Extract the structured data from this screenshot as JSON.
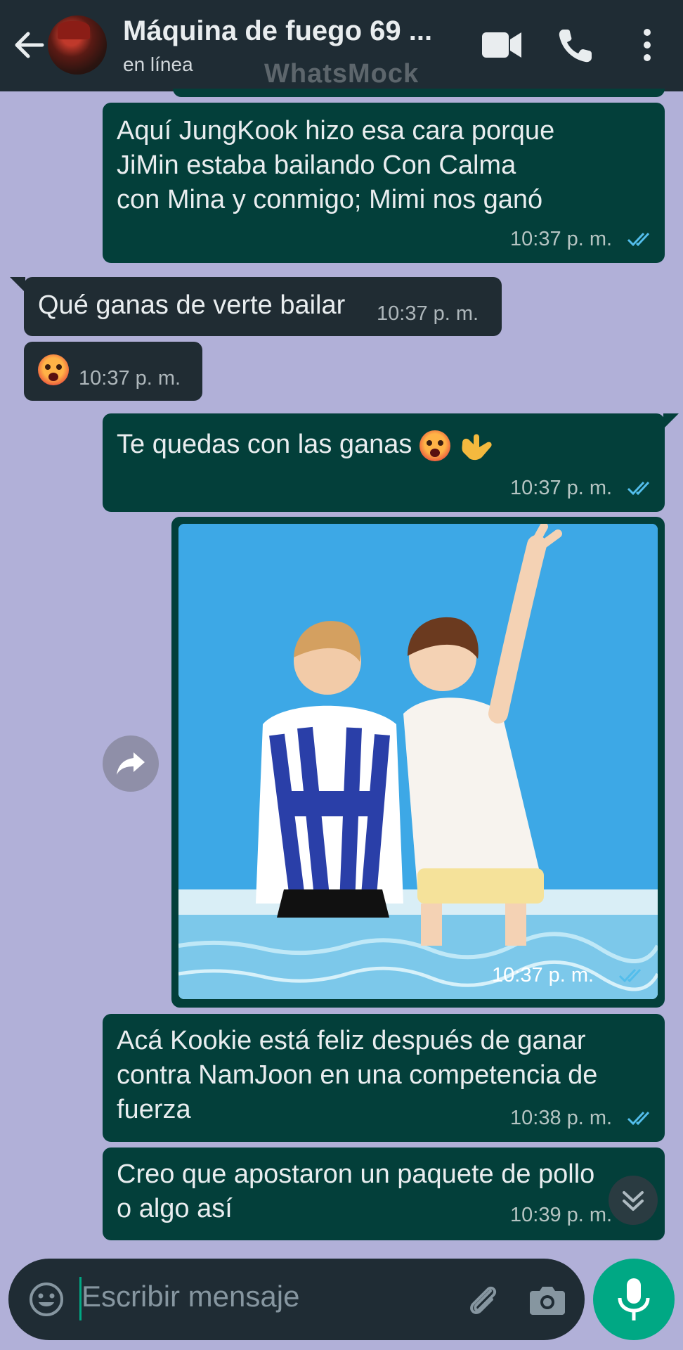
{
  "header": {
    "title": "Máquina de fuego 69 ...",
    "status": "en línea",
    "watermark": "WhatsMock"
  },
  "messages": [
    {
      "direction": "out",
      "text": "Aquí JungKook hizo esa cara porque JiMin estaba bailando Con Calma con Mina y conmigo; Mimi nos ganó",
      "lines": [
        "Aquí JungKook hizo esa cara porque",
        "JiMin estaba bailando Con Calma",
        "con Mina y conmigo; Mimi nos ganó"
      ],
      "time": "10:37 p. m.",
      "read": true
    },
    {
      "direction": "in",
      "text": "Qué ganas de verte bailar",
      "time": "10:37 p. m."
    },
    {
      "direction": "in",
      "text": "",
      "emoji": "hot-face",
      "time": "10:37 p. m."
    },
    {
      "direction": "out",
      "text": "Te quedas con las ganas",
      "emoji": [
        "hot-face",
        "call-me-hand"
      ],
      "time": "10:37 p. m.",
      "read": true
    },
    {
      "direction": "out",
      "type": "image",
      "image": "photo of two people sitting at the edge of a pool by the sea",
      "time": "10:37 p. m.",
      "read": true
    },
    {
      "direction": "out",
      "lines": [
        "Acá Kookie está feliz después de ganar",
        "contra NamJoon en una competencia de",
        "fuerza"
      ],
      "time": "10:38 p. m.",
      "read": true
    },
    {
      "direction": "out",
      "lines": [
        "Creo que apostaron un paquete de pollo",
        "o algo así"
      ],
      "time": "10:39 p. m."
    }
  ],
  "input": {
    "placeholder": "Escribir mensaje"
  },
  "icons": {
    "back": "arrow-left-icon",
    "video": "video-call-icon",
    "phone": "voice-call-icon",
    "more": "more-vert-icon",
    "emoji": "emoji-icon",
    "attach": "paperclip-icon",
    "camera": "camera-icon",
    "mic": "microphone-icon",
    "forward": "forward-icon",
    "scroll": "chevrons-down-icon"
  },
  "colors": {
    "header": "#1f2c34",
    "background": "#b1b0d8",
    "outgoing": "#033f3a",
    "incoming": "#202c33",
    "accent": "#00a884",
    "ticks": "#53bdeb"
  }
}
